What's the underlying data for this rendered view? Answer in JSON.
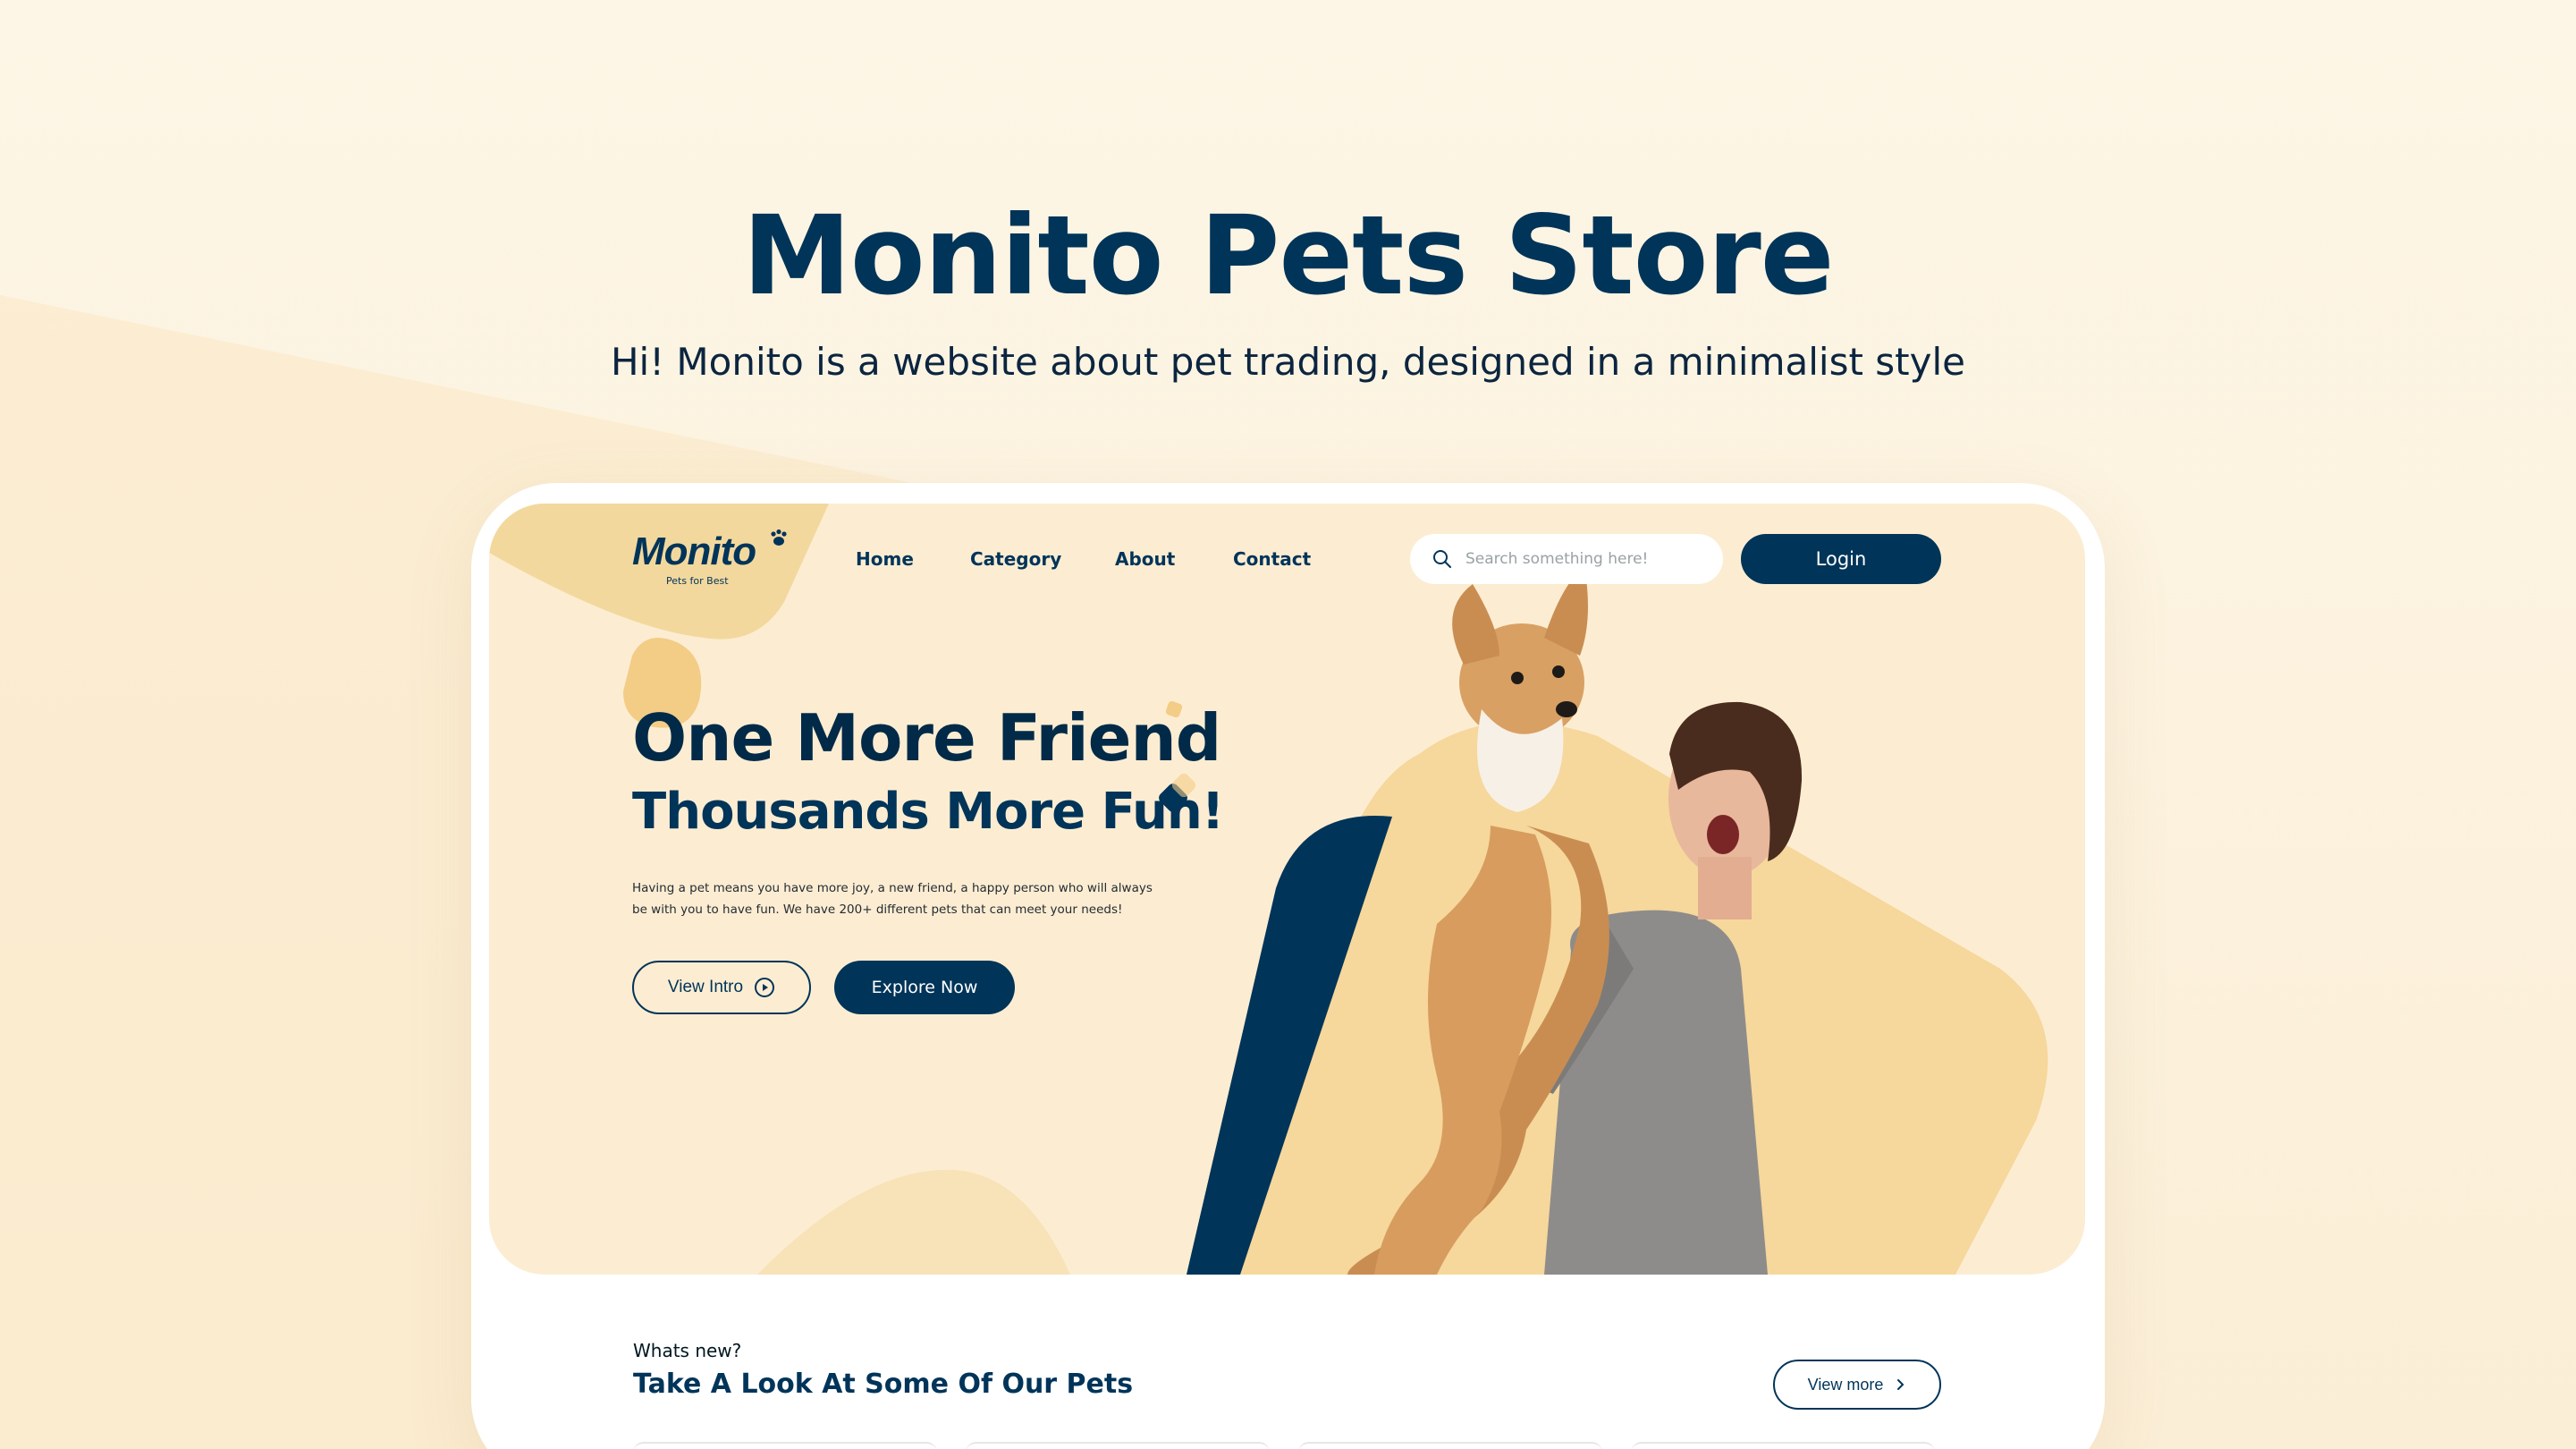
{
  "showcase": {
    "title": "Monito Pets Store",
    "subtitle": "Hi! Monito is a website about pet trading, designed in a minimalist style"
  },
  "brand": {
    "name": "Monito",
    "tagline": "Pets for Best"
  },
  "nav": {
    "items": [
      {
        "label": "Home"
      },
      {
        "label": "Category"
      },
      {
        "label": "About"
      },
      {
        "label": "Contact"
      }
    ]
  },
  "search": {
    "placeholder": "Search something here!",
    "value": ""
  },
  "login": {
    "label": "Login"
  },
  "hero": {
    "headline1": "One More Friend",
    "headline2": "Thousands More Fun!",
    "description": "Having a pet means you have more joy, a new friend, a happy person who will always be with you to have fun. We have 200+ different pets that can meet your needs!",
    "intro_button": "View Intro",
    "explore_button": "Explore Now"
  },
  "section": {
    "label": "Whats new?",
    "title": "Take A Look At Some Of Our Pets",
    "view_more": "View more"
  },
  "colors": {
    "brand": "#003459",
    "hero_bg": "#fcedd2",
    "accent_yellow": "#f6d99f",
    "page_bg": "#fdf6e6"
  },
  "icons": {
    "search": "search-icon",
    "play": "play-circle-icon",
    "chevron": "chevron-right-icon",
    "paw": "paw-icon"
  }
}
